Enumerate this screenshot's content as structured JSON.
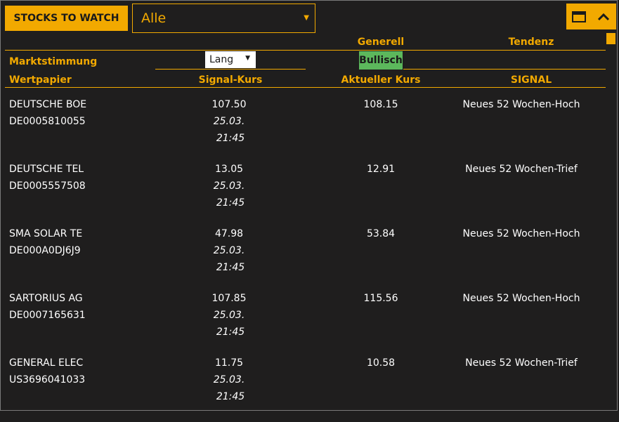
{
  "header": {
    "title": "STOCKS TO WATCH",
    "filter_value": "Alle"
  },
  "top_headers": {
    "generell": "Generell",
    "tendenz": "Tendenz"
  },
  "sentiment": {
    "label": "Marktstimmung",
    "mode_value": "Lang",
    "status": "Bullisch",
    "status_color": "#5cb85c"
  },
  "columns": {
    "security": "Wertpapier",
    "signal_price": "Signal-Kurs",
    "current_price": "Aktueller Kurs",
    "signal": "SIGNAL"
  },
  "rows": [
    {
      "name": "DEUTSCHE BOE",
      "isin": "DE0005810055",
      "signal_price": "107.50",
      "date": "25.03.",
      "time": "21:45",
      "current_price": "108.15",
      "signal": "Neues 52 Wochen-Hoch"
    },
    {
      "name": "DEUTSCHE TEL",
      "isin": "DE0005557508",
      "signal_price": "13.05",
      "date": "25.03.",
      "time": "21:45",
      "current_price": "12.91",
      "signal": "Neues 52 Wochen-Trief"
    },
    {
      "name": "SMA SOLAR TE",
      "isin": "DE000A0DJ6J9",
      "signal_price": "47.98",
      "date": "25.03.",
      "time": "21:45",
      "current_price": "53.84",
      "signal": "Neues 52 Wochen-Hoch"
    },
    {
      "name": "SARTORIUS AG",
      "isin": "DE0007165631",
      "signal_price": "107.85",
      "date": "25.03.",
      "time": "21:45",
      "current_price": "115.56",
      "signal": "Neues 52 Wochen-Hoch"
    },
    {
      "name": "GENERAL ELEC",
      "isin": "US3696041033",
      "signal_price": "11.75",
      "date": "25.03.",
      "time": "21:45",
      "current_price": "10.58",
      "signal": "Neues 52 Wochen-Trief"
    }
  ],
  "colors": {
    "accent": "#f2a900",
    "background": "#1f1e1e"
  }
}
